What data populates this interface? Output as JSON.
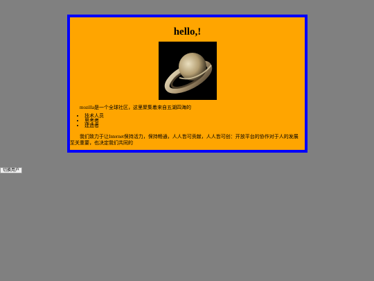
{
  "page": {
    "title": "hello,!",
    "intro": "mozilla是一个全球社区，这里聚集着来自五湖四海的",
    "people": [
      "技术人员",
      "思考者",
      "建造者"
    ],
    "mission": "我们致力于让Internet保持活力，保持畅通，人人皆可贡献，人人皆可创：开放平台的协作对于人的发展至关重要，也决定我们共同的",
    "switch_user_button": "切换用户"
  },
  "image": {
    "alt": "saturn-image"
  }
}
